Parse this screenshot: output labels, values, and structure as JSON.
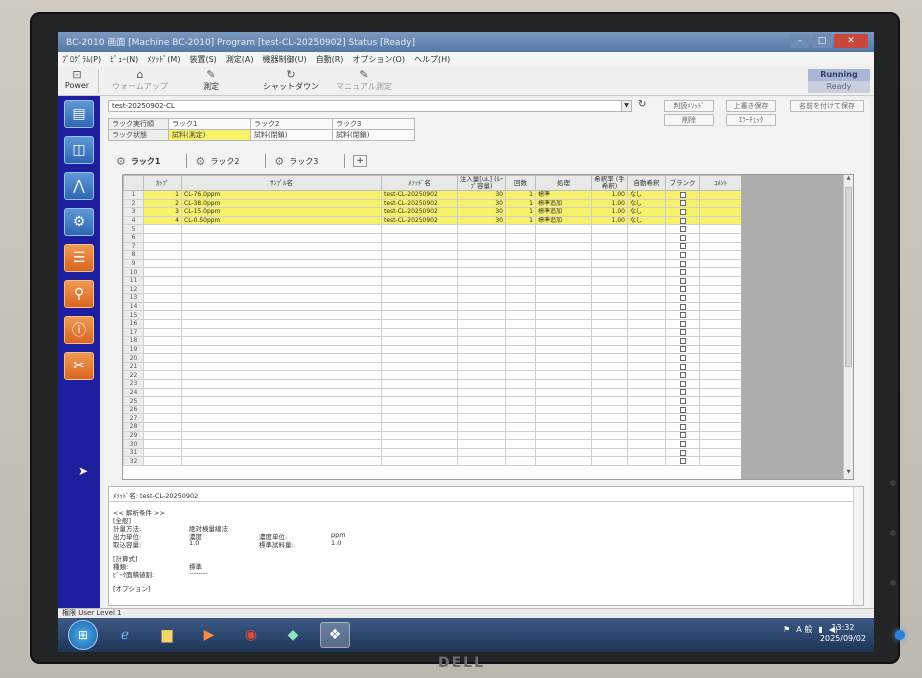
{
  "window": {
    "title": "BC-2010 画面 [Machine BC-2010] Program [test-CL-20250902] Status [Ready]",
    "min": "–",
    "max": "□",
    "close": "✕"
  },
  "menu": [
    "ﾌﾟﾛｸﾞﾗﾑ(P)",
    "ﾋﾞｭｰ(N)",
    "ﾒｿｯﾄﾞ(M)",
    "装置(S)",
    "測定(A)",
    "機器制御(U)",
    "自動(R)",
    "オプション(O)",
    "ヘルプ(H)"
  ],
  "toolbar": {
    "power": "Power",
    "warmup": "ウォームアップ",
    "measure": "測定",
    "shutdown": "シャットダウン",
    "manual": "マニュアル測定"
  },
  "status": {
    "state": "Running",
    "sub": "Ready"
  },
  "method": {
    "selected": "test-20250902-CL",
    "buttons": [
      "判読ﾒｿｯﾄﾞ",
      "上書き保存",
      "名前を付けて保存",
      "削除",
      "ｴﾗｰﾁｪｯｸ"
    ]
  },
  "rack_status": {
    "label_exec": "ラック実行順",
    "label_state": "ラック状態",
    "racks": [
      "ラック1",
      "ラック2",
      "ラック3"
    ],
    "states": [
      "試料(測定)",
      "試料(閉鎖)",
      "試料(閉鎖)"
    ]
  },
  "tabs": [
    "ラック1",
    "ラック2",
    "ラック3"
  ],
  "tab_add": "+",
  "grid": {
    "headers": [
      "",
      "ｶｯﾌﾟ",
      "ｻﾝﾌﾟﾙ名",
      "ﾒｿｯﾄﾞ名",
      "注入量[uL] (ﾙｰﾌﾟ容量)",
      "回数",
      "処理",
      "希釈率 (手希釈)",
      "自動希釈",
      "ブランク",
      "ｺﾒﾝﾄ"
    ],
    "rows": [
      {
        "n": "1",
        "cup": "1",
        "name": "CL-76.0ppm",
        "method": "test-CL-20250902",
        "vol": "30",
        "cnt": "1",
        "proc": "標準",
        "dil": "1.00",
        "auto": "なし"
      },
      {
        "n": "2",
        "cup": "2",
        "name": "CL-38.0ppm",
        "method": "test-CL-20250902",
        "vol": "30",
        "cnt": "1",
        "proc": "標準追加",
        "dil": "1.00",
        "auto": "なし"
      },
      {
        "n": "3",
        "cup": "3",
        "name": "CL-15.0ppm",
        "method": "test-CL-20250902",
        "vol": "30",
        "cnt": "1",
        "proc": "標準追加",
        "dil": "1.00",
        "auto": "なし"
      },
      {
        "n": "4",
        "cup": "4",
        "name": "CL-0.50ppm",
        "method": "test-CL-20250902",
        "vol": "30",
        "cnt": "1",
        "proc": "標準追加",
        "dil": "1.00",
        "auto": "なし"
      }
    ],
    "row_count": 32
  },
  "info": {
    "method_line": "ﾒｿｯﾄﾞ名: test-CL-20250902",
    "section": "<< 解析条件 >>",
    "group1": "[全般]",
    "k1": "計量方法:",
    "v1": "絶対検量線法",
    "k2": "出力単位:",
    "v2": "濃度",
    "k3": "取込容量:",
    "v3": "1.0",
    "k4": "濃度単位:",
    "v4": "ppm",
    "k5": "標準試料量:",
    "v5": "1.0",
    "group2": "[計算式]",
    "k6": "種類:",
    "v6": "標準",
    "k7": "ﾋﾟｰｸ面積値割:",
    "v7": "--------",
    "group3": "[オプション]"
  },
  "statusbar": {
    "user": "権限 User Level 1"
  },
  "tray": {
    "ime": "A 般",
    "clock_time": "13:32",
    "clock_date": "2025/09/02"
  },
  "brand": "DELL"
}
